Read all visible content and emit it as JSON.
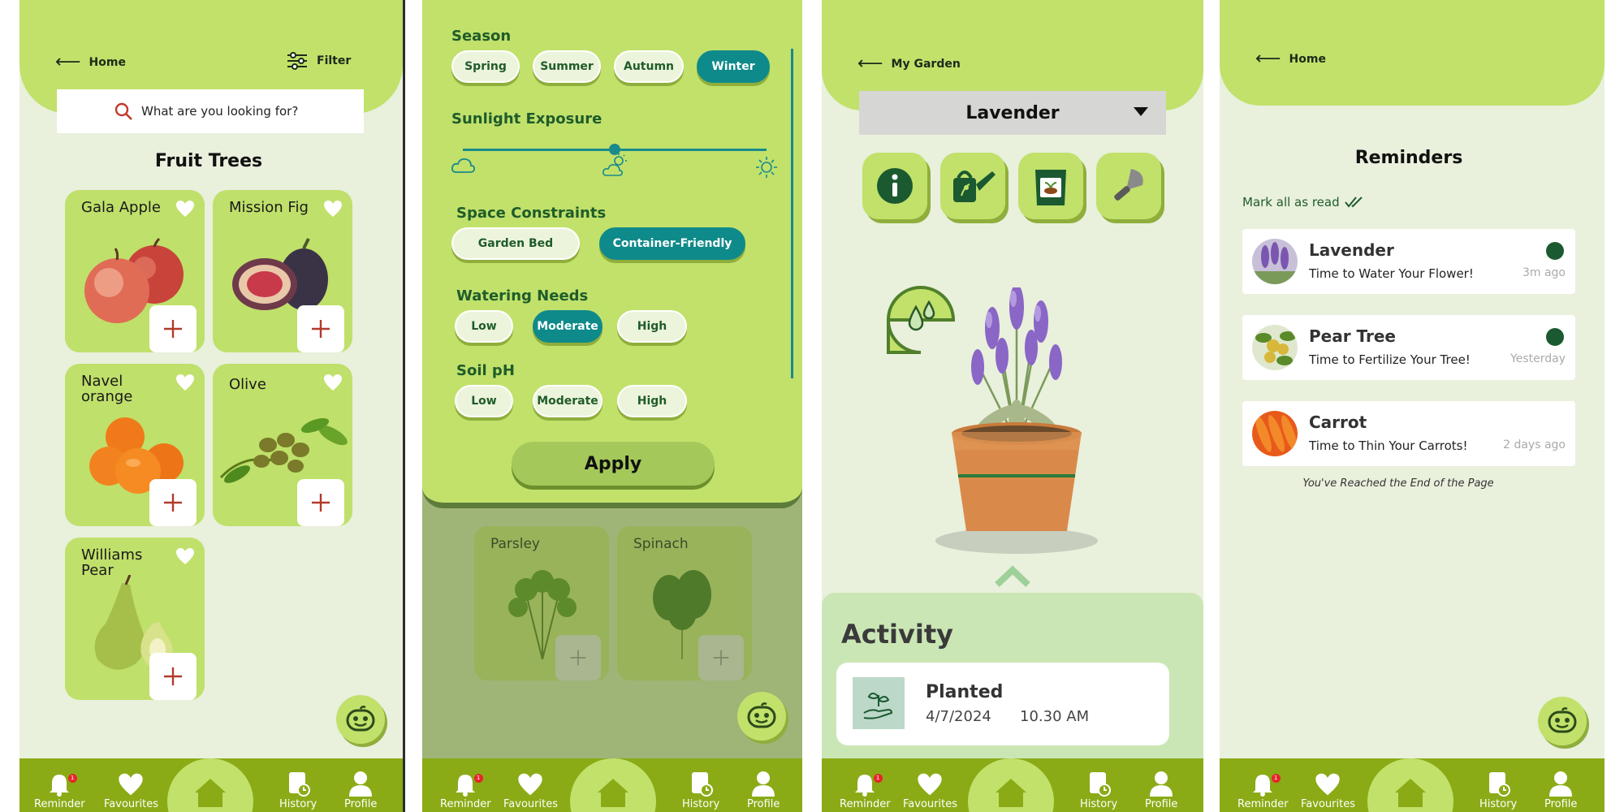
{
  "colors": {
    "primary_green": "#c1e16b",
    "nav_green": "#8aab16",
    "teal_selected": "#0f8a8a",
    "dark_green_text": "#1f5c2a",
    "plus_red": "#b23a2a"
  },
  "nav": {
    "items": [
      {
        "label": "Reminder",
        "icon": "bell-icon",
        "badge": "1"
      },
      {
        "label": "Favourites",
        "icon": "heart-icon"
      },
      {
        "label": "",
        "icon": "home-icon"
      },
      {
        "label": "History",
        "icon": "history-icon"
      },
      {
        "label": "Profile",
        "icon": "profile-icon"
      }
    ]
  },
  "screen1": {
    "back_label": "Home",
    "filter_label": "Filter",
    "search_placeholder": "What are you looking for?",
    "title": "Fruit Trees",
    "cards": [
      {
        "name": "Gala Apple"
      },
      {
        "name": "Mission Fig"
      },
      {
        "name": "Navel orange"
      },
      {
        "name": "Olive"
      },
      {
        "name": "Williams Pear"
      }
    ]
  },
  "screen2": {
    "season": {
      "label": "Season",
      "options": [
        "Spring",
        "Summer",
        "Autumn",
        "Winter"
      ],
      "selected": "Winter"
    },
    "sunlight": {
      "label": "Sunlight Exposure",
      "level": 0.5
    },
    "space": {
      "label": "Space Constraints",
      "options": [
        "Garden Bed",
        "Container-Friendly"
      ],
      "selected": "Container-Friendly"
    },
    "watering": {
      "label": "Watering Needs",
      "options": [
        "Low",
        "Moderate",
        "High"
      ],
      "selected": "Moderate"
    },
    "soil": {
      "label": "Soil pH",
      "options": [
        "Low",
        "Moderate",
        "High"
      ]
    },
    "apply_label": "Apply",
    "background_cards": [
      {
        "name": "Parsley"
      },
      {
        "name": "Spinach"
      }
    ]
  },
  "screen3": {
    "back_label": "My Garden",
    "plant_select": "Lavender",
    "activity_title": "Activity",
    "activity": {
      "title": "Planted",
      "date": "4/7/2024",
      "time": "10.30 AM"
    }
  },
  "screen4": {
    "back_label": "Home",
    "title": "Reminders",
    "mark_all": "Mark all as read",
    "reminders": [
      {
        "title": "Lavender",
        "text": "Time to Water Your Flower!",
        "time": "3m ago",
        "unread": true
      },
      {
        "title": "Pear Tree",
        "text": "Time to Fertilize Your Tree!",
        "time": "Yesterday",
        "unread": true
      },
      {
        "title": "Carrot",
        "text": "Time to Thin Your Carrots!",
        "time": "2 days ago",
        "unread": false
      }
    ],
    "end_text": "You've Reached the End of the Page"
  }
}
